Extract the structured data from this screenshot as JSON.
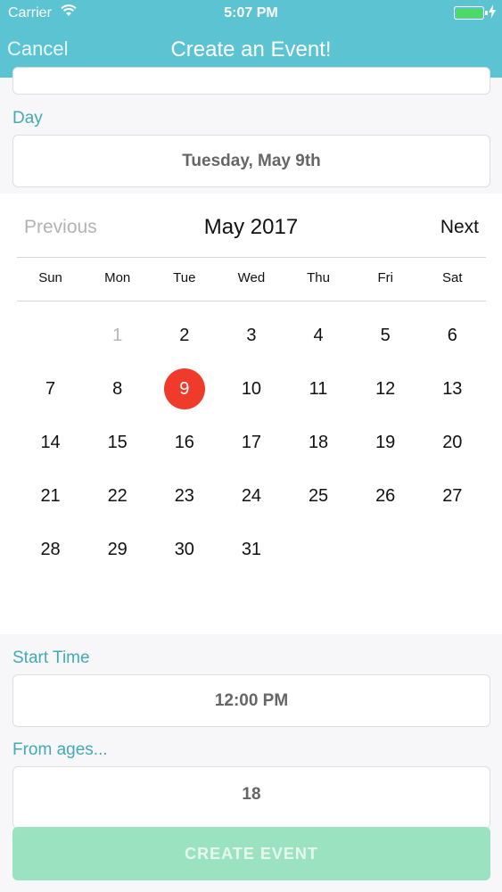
{
  "status_bar": {
    "carrier": "Carrier",
    "time": "5:07 PM"
  },
  "nav": {
    "cancel_label": "Cancel",
    "title": "Create an Event!"
  },
  "form": {
    "day_label": "Day",
    "day_value": "Tuesday, May 9th",
    "start_time_label": "Start Time",
    "start_time_value": "12:00 PM",
    "from_ages_label": "From ages...",
    "from_ages_value": "18",
    "submit_label": "CREATE EVENT"
  },
  "calendar": {
    "previous_label": "Previous",
    "next_label": "Next",
    "month_label": "May 2017",
    "weekdays": [
      "Sun",
      "Mon",
      "Tue",
      "Wed",
      "Thu",
      "Fri",
      "Sat"
    ],
    "weeks": [
      [
        "",
        "1",
        "2",
        "3",
        "4",
        "5",
        "6"
      ],
      [
        "7",
        "8",
        "9",
        "10",
        "11",
        "12",
        "13"
      ],
      [
        "14",
        "15",
        "16",
        "17",
        "18",
        "19",
        "20"
      ],
      [
        "21",
        "22",
        "23",
        "24",
        "25",
        "26",
        "27"
      ],
      [
        "28",
        "29",
        "30",
        "31",
        "",
        "",
        ""
      ]
    ],
    "selected_day": "9",
    "muted_day": "1",
    "selected_color": "#ee3b2b"
  },
  "theme": {
    "header_color": "#5bc3d2",
    "accent_text": "#43a9b5",
    "button_color": "#9be3c0"
  }
}
